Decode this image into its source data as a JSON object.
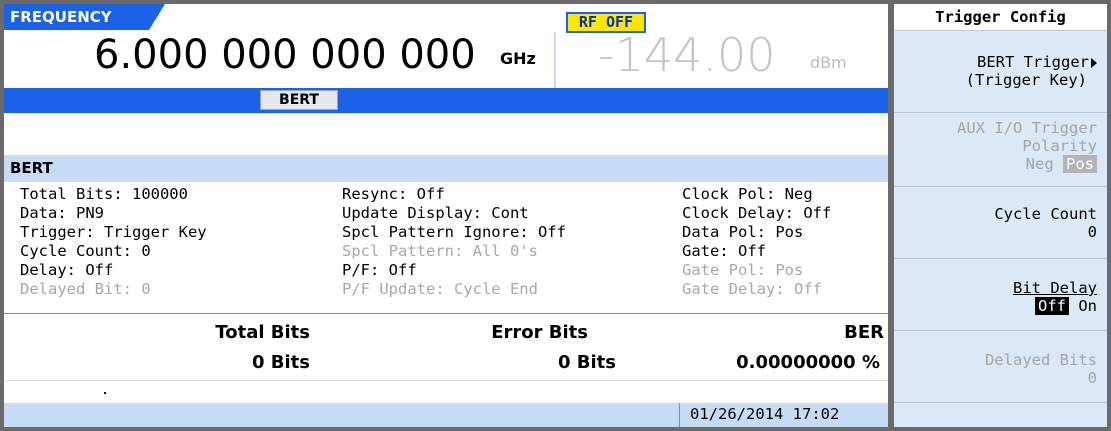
{
  "header": {
    "frequency_label": "FREQUENCY",
    "rf_status": "RF OFF",
    "frequency_value": "6.000 000 000 000",
    "frequency_unit": "GHz",
    "amplitude_value": "-144.00",
    "amplitude_unit": "dBm",
    "mode_tab": "BERT"
  },
  "section": {
    "title": "BERT"
  },
  "params": {
    "col1": [
      {
        "text": "Total Bits: 100000",
        "dim": false
      },
      {
        "text": "Data: PN9",
        "dim": false
      },
      {
        "text": "Trigger: Trigger Key",
        "dim": false
      },
      {
        "text": "Cycle Count: 0",
        "dim": false
      },
      {
        "text": "Delay: Off",
        "dim": false
      },
      {
        "text": "Delayed Bit: 0",
        "dim": true
      }
    ],
    "col2": [
      {
        "text": "Resync: Off",
        "dim": false
      },
      {
        "text": "Update Display: Cont",
        "dim": false
      },
      {
        "text": "Spcl Pattern Ignore: Off",
        "dim": false
      },
      {
        "text": "Spcl Pattern: All 0's",
        "dim": true
      },
      {
        "text": "P/F: Off",
        "dim": false
      },
      {
        "text": "P/F Update: Cycle End",
        "dim": true
      }
    ],
    "col3": [
      {
        "text": "Clock Pol: Neg",
        "dim": false
      },
      {
        "text": "Clock Delay: Off",
        "dim": false
      },
      {
        "text": "Data Pol: Pos",
        "dim": false
      },
      {
        "text": "Gate: Off",
        "dim": false
      },
      {
        "text": "Gate Pol: Pos",
        "dim": true
      },
      {
        "text": "Gate Delay: Off",
        "dim": true
      }
    ]
  },
  "results": {
    "total_bits_label": "Total Bits",
    "error_bits_label": "Error Bits",
    "ber_label": "BER",
    "total_bits_value": "0 Bits",
    "error_bits_value": "0 Bits",
    "ber_value": "0.00000000 %"
  },
  "status_bar": {
    "timestamp": "01/26/2014 17:02"
  },
  "softkeys": {
    "title": "Trigger Config",
    "bert_trigger_line1": "BERT Trigger",
    "bert_trigger_line2": "(Trigger Key)",
    "aux_line1": "AUX I/O Trigger",
    "aux_line2": "Polarity",
    "aux_opt_neg": "Neg",
    "aux_opt_pos": "Pos",
    "cycle_count_label": "Cycle Count",
    "cycle_count_value": "0",
    "bit_delay_label": "Bit Delay",
    "bit_delay_opt_off": "Off",
    "bit_delay_opt_on": "On",
    "delayed_bits_label": "Delayed Bits",
    "delayed_bits_value": "0"
  },
  "colors": {
    "accent_blue": "#1a62e8",
    "panel_bg": "#dbe8f6",
    "rf_status_bg": "#ffe700",
    "dim_text": "#a8a8a8"
  }
}
